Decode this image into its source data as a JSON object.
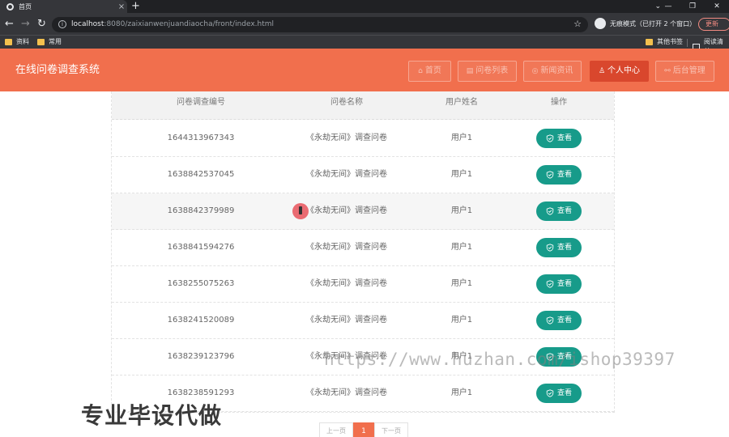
{
  "browser": {
    "tab_title": "首页",
    "tab_close": "×",
    "new_tab": "+",
    "url_host": "localhost",
    "url_rest": ":8080/zaixianwenjuandiaocha/front/index.html",
    "incognito_label": "无痕模式（已打开 2 个窗口）",
    "update_label": "更新",
    "bookmarks": [
      "资料",
      "常用"
    ],
    "bookmarks_right": [
      "其他书签",
      "阅读清单"
    ]
  },
  "site": {
    "title": "在线问卷调查系统",
    "nav": [
      {
        "label": "首页",
        "icon": "home-icon",
        "active": false
      },
      {
        "label": "问卷列表",
        "icon": "list-icon",
        "active": false
      },
      {
        "label": "新闻资讯",
        "icon": "news-icon",
        "active": false
      },
      {
        "label": "个人中心",
        "icon": "user-icon",
        "active": true
      },
      {
        "label": "后台管理",
        "icon": "link-icon",
        "active": false
      }
    ]
  },
  "table": {
    "headers": [
      "问卷调查编号",
      "问卷名称",
      "用户姓名",
      "操作"
    ],
    "action_label": "查看",
    "rows": [
      {
        "id": "1644313967343",
        "name": "《永劫无间》调查问卷",
        "user": "用户1"
      },
      {
        "id": "1638842537045",
        "name": "《永劫无间》调查问卷",
        "user": "用户1"
      },
      {
        "id": "1638842379989",
        "name": "《永劫无间》调查问卷",
        "user": "用户1"
      },
      {
        "id": "1638841594276",
        "name": "《永劫无间》调查问卷",
        "user": "用户1"
      },
      {
        "id": "1638255075263",
        "name": "《永劫无间》调查问卷",
        "user": "用户1"
      },
      {
        "id": "1638241520089",
        "name": "《永劫无间》调查问卷",
        "user": "用户1"
      },
      {
        "id": "1638239123796",
        "name": "《永劫无间》调查问卷",
        "user": "用户1"
      },
      {
        "id": "1638238591293",
        "name": "《永劫无间》调查问卷",
        "user": "用户1"
      }
    ]
  },
  "pagination": {
    "prev": "上一页",
    "current": "1",
    "next": "下一页"
  },
  "overlay": {
    "watermark": "https://www.huzhan.com/ishop39397",
    "promo": "专业毕设代做"
  },
  "colors": {
    "header": "#f16f4d",
    "active_nav": "#d9472d",
    "action_button": "#179b8a"
  }
}
